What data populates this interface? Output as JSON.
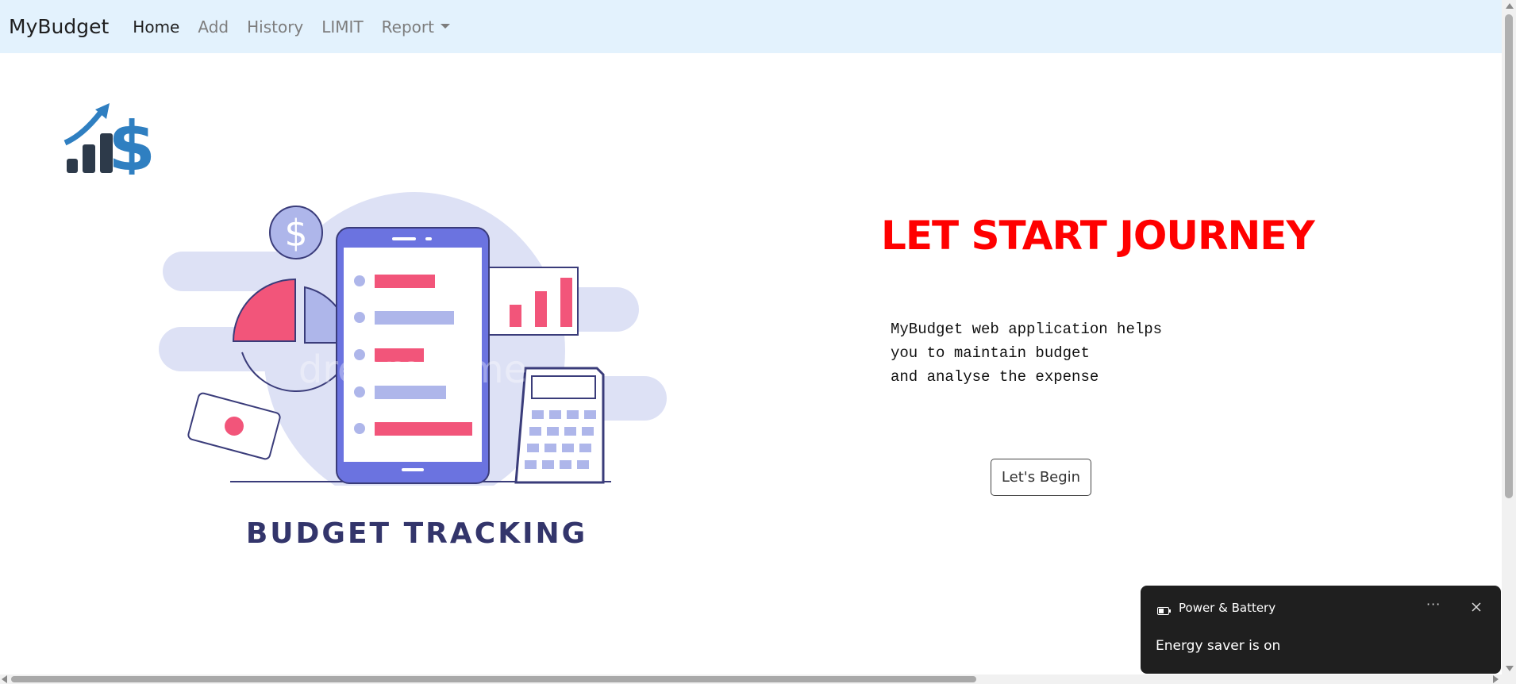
{
  "navbar": {
    "brand": "MyBudget",
    "links": [
      {
        "label": "Home"
      },
      {
        "label": "Add"
      },
      {
        "label": "History"
      },
      {
        "label": "LIMIT"
      },
      {
        "label": "Report"
      }
    ]
  },
  "illustration": {
    "caption": "BUDGET TRACKING",
    "watermark": "dreamstime"
  },
  "hero": {
    "title": "LET START JOURNEY",
    "description_lines": [
      "MyBudget web application helps",
      "you to maintain budget",
      "and analyse the expense"
    ],
    "button_label": "Let's Begin"
  },
  "toast": {
    "title": "Power & Battery",
    "more": "···",
    "message": "Energy saver is on"
  },
  "colors": {
    "navbar_bg": "#e3f2fd",
    "hero_title": "#ff0000",
    "logo_dark": "#2d3a4a",
    "logo_blue": "#2f7fc1",
    "illus_purple": "#6b73e0",
    "illus_pink": "#f2557a",
    "illus_lavender": "#aeb6ea"
  }
}
